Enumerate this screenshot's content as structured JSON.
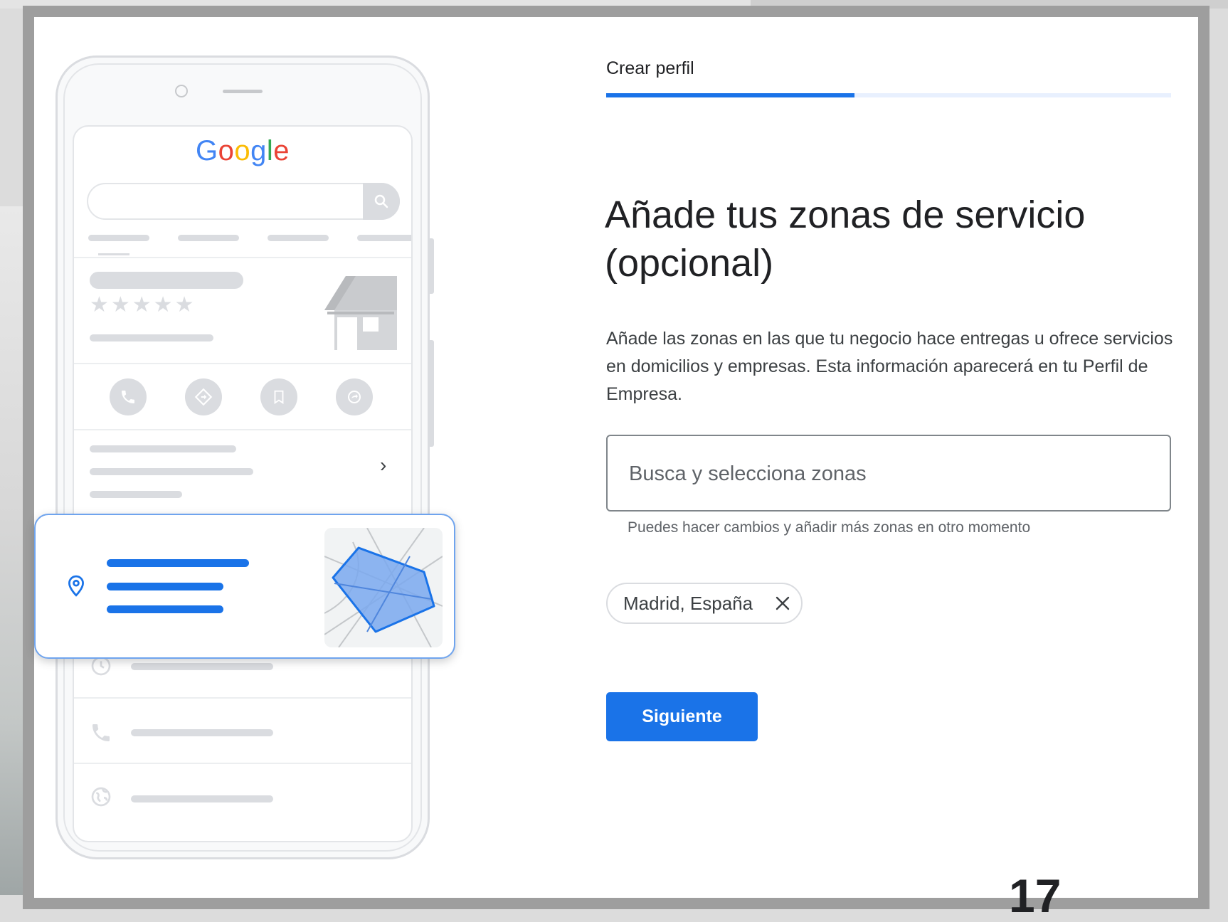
{
  "illustration": {
    "logo_letters": [
      {
        "char": "G",
        "color": "#4285F4"
      },
      {
        "char": "o",
        "color": "#EA4335"
      },
      {
        "char": "o",
        "color": "#FBBC05"
      },
      {
        "char": "g",
        "color": "#4285F4"
      },
      {
        "char": "l",
        "color": "#34A853"
      },
      {
        "char": "e",
        "color": "#EA4335"
      }
    ],
    "rating_stars": "★★★★★",
    "chevron": "›",
    "icons": [
      "search-icon",
      "phone-icon",
      "directions-icon",
      "bookmark-icon",
      "share-icon",
      "clock-icon",
      "phone-icon",
      "globe-icon",
      "map-pin-icon",
      "storefront-icon"
    ]
  },
  "header": {
    "step_label": "Crear perfil",
    "progress": 0.44
  },
  "main": {
    "title": "Añade tus zonas de servicio (opcional)",
    "description": "Añade las zonas en las que tu negocio hace entregas u ofrece servicios en domicilios y empresas. Esta información aparecerá en tu Perfil de Empresa.",
    "search": {
      "placeholder": "Busca y selecciona zonas",
      "value": "",
      "helper": "Puedes hacer cambios y añadir más zonas en otro momento"
    },
    "chips": [
      {
        "label": "Madrid, España"
      }
    ],
    "next_button": "Siguiente"
  },
  "page_number": "17",
  "colors": {
    "accent": "#1a73e8",
    "frame": "#9e9e9e",
    "placeholder_gray": "#dadce0"
  }
}
